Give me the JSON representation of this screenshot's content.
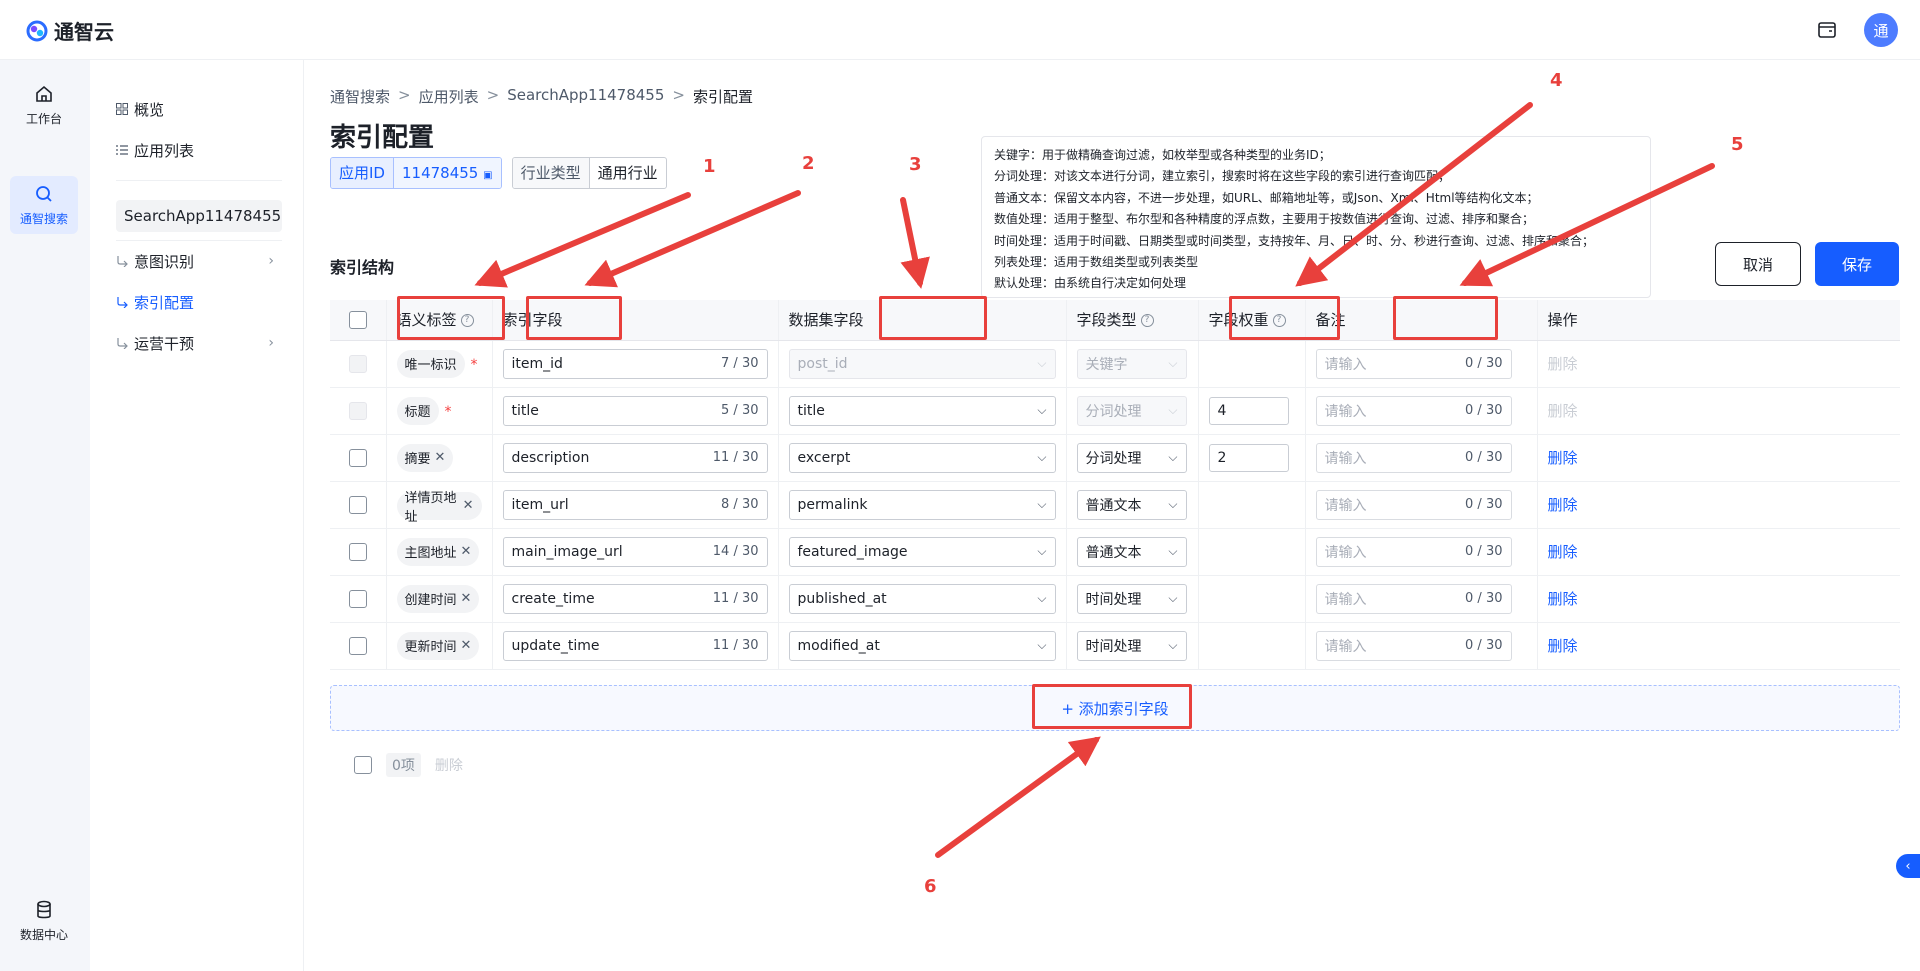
{
  "brand": {
    "name": "通智云",
    "avatar_text": "通"
  },
  "rail": [
    {
      "label": "工作台",
      "icon": "home-icon"
    },
    {
      "label": "通智搜索",
      "icon": "search-icon"
    },
    {
      "label": "数据中心",
      "icon": "database-icon"
    }
  ],
  "subnav": {
    "overview": "概览",
    "app_list": "应用列表",
    "app_name": "SearchApp11478455",
    "intent": "意图识别",
    "index_config": "索引配置",
    "ops": "运营干预"
  },
  "breadcrumb": [
    "通智搜索",
    "应用列表",
    "SearchApp11478455",
    "索引配置"
  ],
  "page_title": "索引配置",
  "app_id": {
    "label": "应用ID",
    "value": "11478455"
  },
  "industry": {
    "label": "行业类型",
    "value": "通用行业"
  },
  "tooltip_lines": [
    "关键字：用于做精确查询过滤，如枚举型或各种类型的业务ID；",
    "分词处理：对该文本进行分词，建立索引，搜索时将在这些字段的索引进行查询匹配；",
    "普通文本：保留文本内容，不进一步处理，如URL、邮箱地址等，或Json、Xml、Html等结构化文本；",
    "数值处理：适用于整型、布尔型和各种精度的浮点数，主要用于按数值进行查询、过滤、排序和聚合；",
    "时间处理：适用于时间戳、日期类型或时间类型，支持按年、月、日、时、分、秒进行查询、过滤、排序和聚合；",
    "列表处理：适用于数组类型或列表类型",
    "默认处理：由系统自行决定如何处理"
  ],
  "section_title": "索引结构",
  "buttons": {
    "cancel": "取消",
    "save": "保存"
  },
  "columns": {
    "label": "语义标签",
    "field": "索引字段",
    "dataset": "数据集字段",
    "type": "字段类型",
    "weight": "字段权重",
    "remark": "备注",
    "op": "操作"
  },
  "rows": [
    {
      "label": "唯一标识",
      "required": "*",
      "field": "item_id",
      "count": "7 / 30",
      "dataset": "post_id",
      "type": "关键字",
      "weight": "",
      "remark_ph": "请输入",
      "remark_count": "0 / 30",
      "op": "删除",
      "locked": true
    },
    {
      "label": "标题",
      "required": "*",
      "field": "title",
      "count": "5 / 30",
      "dataset": "title",
      "type": "分词处理",
      "weight": "4",
      "remark_ph": "请输入",
      "remark_count": "0 / 30",
      "op": "删除",
      "locked": true
    },
    {
      "label": "摘要",
      "required": "",
      "field": "description",
      "count": "11 / 30",
      "dataset": "excerpt",
      "type": "分词处理",
      "weight": "2",
      "remark_ph": "请输入",
      "remark_count": "0 / 30",
      "op": "删除",
      "locked": false
    },
    {
      "label": "详情页地址",
      "required": "",
      "field": "item_url",
      "count": "8 / 30",
      "dataset": "permalink",
      "type": "普通文本",
      "weight": "",
      "remark_ph": "请输入",
      "remark_count": "0 / 30",
      "op": "删除",
      "locked": false
    },
    {
      "label": "主图地址",
      "required": "",
      "field": "main_image_url",
      "count": "14 / 30",
      "dataset": "featured_image",
      "type": "普通文本",
      "weight": "",
      "remark_ph": "请输入",
      "remark_count": "0 / 30",
      "op": "删除",
      "locked": false
    },
    {
      "label": "创建时间",
      "required": "",
      "field": "create_time",
      "count": "11 / 30",
      "dataset": "published_at",
      "type": "时间处理",
      "weight": "",
      "remark_ph": "请输入",
      "remark_count": "0 / 30",
      "op": "删除",
      "locked": false
    },
    {
      "label": "更新时间",
      "required": "",
      "field": "update_time",
      "count": "11 / 30",
      "dataset": "modified_at",
      "type": "时间处理",
      "weight": "",
      "remark_ph": "请输入",
      "remark_count": "0 / 30",
      "op": "删除",
      "locked": false
    }
  ],
  "add_field": "+ 添加索引字段",
  "footer": {
    "selected": "0项",
    "delete": "删除"
  },
  "annotations": [
    "1",
    "2",
    "3",
    "4",
    "5",
    "6"
  ],
  "annotation_color": "#e8403c",
  "accent": "#165dff"
}
